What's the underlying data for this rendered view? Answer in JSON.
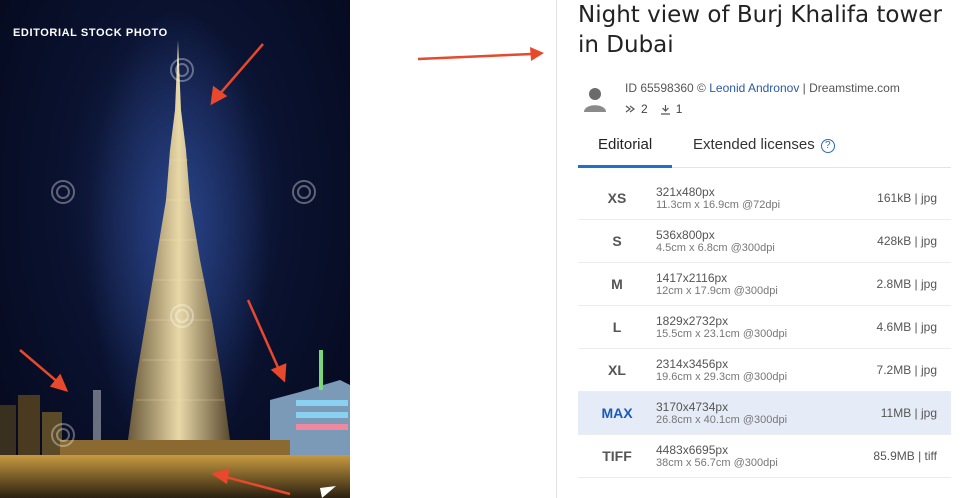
{
  "photo": {
    "badge": "EDITORIAL STOCK PHOTO",
    "watermark": "dreamstime",
    "accent_arrow_color": "#e8482c"
  },
  "listing": {
    "title": "Night view of Burj Khalifa tower in Dubai",
    "id_label": "ID 65598360 ©",
    "author": "Leonid Andronov",
    "separator": "|",
    "site": "Dreamstime.com",
    "views": "2",
    "downloads": "1"
  },
  "tabs": {
    "editorial": "Editorial",
    "extended": "Extended licenses",
    "help": "?"
  },
  "sizes": [
    {
      "code": "XS",
      "px": "321x480px",
      "cm": "11.3cm x 16.9cm @72dpi",
      "file": "161kB | jpg",
      "selected": false
    },
    {
      "code": "S",
      "px": "536x800px",
      "cm": "4.5cm x 6.8cm @300dpi",
      "file": "428kB | jpg",
      "selected": false
    },
    {
      "code": "M",
      "px": "1417x2116px",
      "cm": "12cm x 17.9cm @300dpi",
      "file": "2.8MB | jpg",
      "selected": false
    },
    {
      "code": "L",
      "px": "1829x2732px",
      "cm": "15.5cm x 23.1cm @300dpi",
      "file": "4.6MB | jpg",
      "selected": false
    },
    {
      "code": "XL",
      "px": "2314x3456px",
      "cm": "19.6cm x 29.3cm @300dpi",
      "file": "7.2MB | jpg",
      "selected": false
    },
    {
      "code": "MAX",
      "px": "3170x4734px",
      "cm": "26.8cm x 40.1cm @300dpi",
      "file": "11MB | jpg",
      "selected": true
    },
    {
      "code": "TIFF",
      "px": "4483x6695px",
      "cm": "38cm x 56.7cm @300dpi",
      "file": "85.9MB | tiff",
      "selected": false
    }
  ]
}
